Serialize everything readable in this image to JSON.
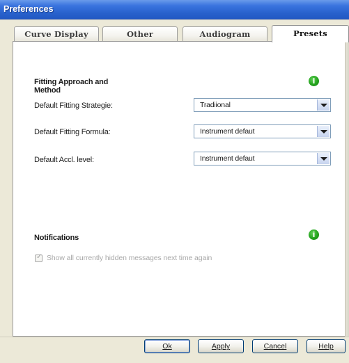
{
  "window": {
    "title": "Preferences"
  },
  "tabs": [
    {
      "label": "Curve Display",
      "active": false
    },
    {
      "label": "Other",
      "active": false
    },
    {
      "label": "Audiogram",
      "active": false
    },
    {
      "label": "Presets",
      "active": true
    }
  ],
  "fitting": {
    "section_title_line1": "Fitting Approach and",
    "section_title_line2": "Method",
    "info_icon": "info-icon",
    "info_glyph": "i",
    "rows": [
      {
        "label": "Default Fitting Strategie:",
        "value": "Tradiional"
      },
      {
        "label": "Default Fitting Formula:",
        "value": "Instrument defaut"
      },
      {
        "label": "Default Accl. level:",
        "value": "Instrument defaut"
      }
    ]
  },
  "notifications": {
    "section_title": "Notifications",
    "info_icon": "info-icon",
    "info_glyph": "i",
    "checkbox_label": "Show all currently hidden messages next time again",
    "checked": true,
    "enabled": false
  },
  "buttons": {
    "ok": "Ok",
    "apply": "Apply",
    "cancel": "Cancel",
    "help": "Help"
  },
  "colors": {
    "titlebar": "#2861cc",
    "info_icon": "#24a31d",
    "window_bg": "#ece9d8"
  }
}
